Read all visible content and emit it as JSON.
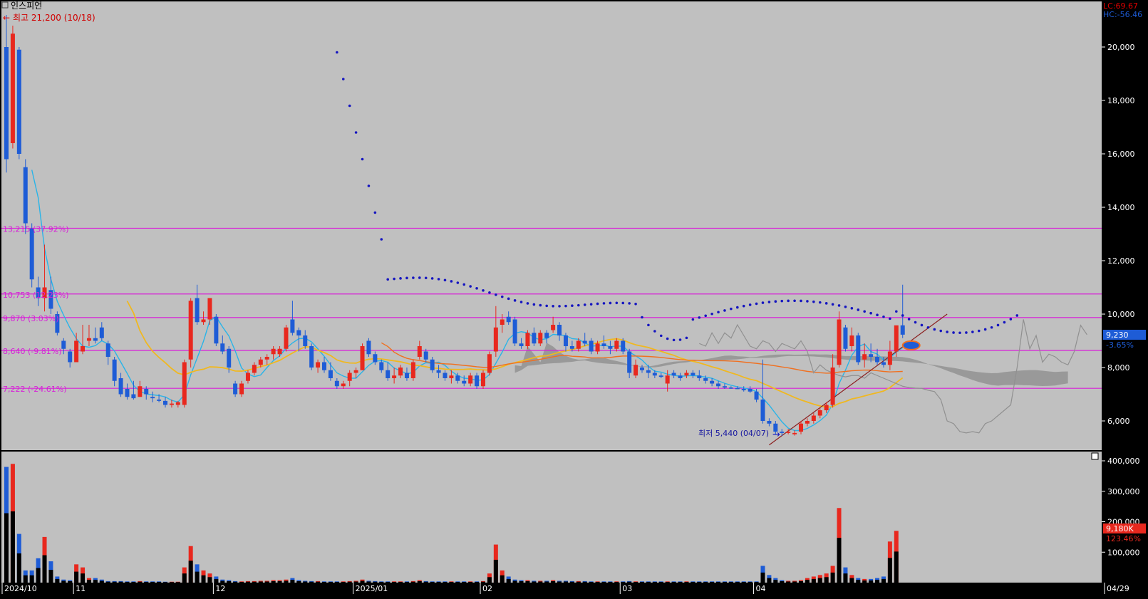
{
  "header": {
    "title": "인스피언",
    "high_label": "최고 21,200 (10/18)",
    "low_label": "최저 5,440 (04/07)"
  },
  "indicators": {
    "lc": "LC:69.67",
    "hc": "HC:-56.46"
  },
  "price_box": {
    "value": "9,230",
    "change": "-3.65%"
  },
  "volume_box": {
    "value": "9,180K",
    "pct": "123.46%"
  },
  "colors": {
    "up": "#e8281e",
    "down": "#1e5cd6",
    "sar": "#1515c0",
    "line_pink": "#d81fd8",
    "ma_cyan": "#29b4e8",
    "ma_yellow": "#f0b820",
    "ma_orange": "#f07020"
  },
  "chart_data": [
    {
      "type": "candlestick",
      "y_ticks": [
        "20,000",
        "18,000",
        "16,000",
        "14,000",
        "12,000",
        "10,000",
        "8,000",
        "6,000"
      ],
      "ylim": [
        5000,
        22000
      ],
      "x_labels": [
        {
          "label": "2024/10",
          "i": 0
        },
        {
          "label": "11",
          "i": 11
        },
        {
          "label": "12",
          "i": 33
        },
        {
          "label": "2025/01",
          "i": 55
        },
        {
          "label": "02",
          "i": 75
        },
        {
          "label": "03",
          "i": 97
        },
        {
          "label": "04",
          "i": 118
        },
        {
          "label": "04/29",
          "i": 174
        }
      ],
      "ohlc": [
        [
          20000,
          21200,
          15300,
          15800
        ],
        [
          16400,
          20800,
          16200,
          20500
        ],
        [
          19900,
          20000,
          15800,
          16000
        ],
        [
          15500,
          15800,
          13000,
          13400
        ],
        [
          13200,
          13400,
          11000,
          11300
        ],
        [
          11000,
          11400,
          10300,
          10600
        ],
        [
          10600,
          12600,
          10100,
          11000
        ],
        [
          10900,
          11400,
          10000,
          10200
        ],
        [
          10000,
          10100,
          9200,
          9300
        ],
        [
          9000,
          9100,
          8500,
          8700
        ],
        [
          8600,
          8700,
          8000,
          8200
        ],
        [
          8200,
          9300,
          8200,
          9000
        ],
        [
          8600,
          9600,
          8500,
          8800
        ],
        [
          9000,
          9600,
          8800,
          9100
        ],
        [
          9100,
          9500,
          8900,
          9000
        ],
        [
          9500,
          9700,
          9000,
          9100
        ],
        [
          8900,
          9000,
          8100,
          8400
        ],
        [
          8300,
          8400,
          7300,
          7500
        ],
        [
          7600,
          7800,
          6900,
          7000
        ],
        [
          7200,
          7400,
          6800,
          6900
        ],
        [
          7000,
          7500,
          6800,
          6850
        ],
        [
          6900,
          7500,
          6900,
          7300
        ],
        [
          7200,
          7300,
          6800,
          7000
        ],
        [
          6900,
          7100,
          6700,
          6850
        ],
        [
          6800,
          7000,
          6700,
          6750
        ],
        [
          6750,
          6900,
          6500,
          6600
        ],
        [
          6600,
          6800,
          6500,
          6650
        ],
        [
          6600,
          6750,
          6500,
          6700
        ],
        [
          6600,
          8300,
          6500,
          8200
        ],
        [
          8300,
          10600,
          8000,
          10500
        ],
        [
          10600,
          11100,
          9600,
          9700
        ],
        [
          9700,
          10100,
          9600,
          9800
        ],
        [
          9800,
          10600,
          9600,
          10600
        ],
        [
          9900,
          10000,
          8800,
          8900
        ],
        [
          8900,
          9200,
          8500,
          8600
        ],
        [
          8700,
          8800,
          7800,
          8000
        ],
        [
          7400,
          7500,
          6900,
          7000
        ],
        [
          7000,
          7500,
          6900,
          7400
        ],
        [
          7500,
          7900,
          7400,
          7800
        ],
        [
          7800,
          8200,
          7700,
          8100
        ],
        [
          8100,
          8400,
          8000,
          8300
        ],
        [
          8300,
          8500,
          8100,
          8400
        ],
        [
          8500,
          8800,
          8300,
          8700
        ],
        [
          8500,
          8800,
          8400,
          8700
        ],
        [
          8700,
          9600,
          8600,
          9500
        ],
        [
          9800,
          10500,
          9200,
          9300
        ],
        [
          9400,
          9500,
          8600,
          9200
        ],
        [
          9200,
          9400,
          8700,
          8800
        ],
        [
          8800,
          8900,
          7900,
          8000
        ],
        [
          8000,
          8300,
          7800,
          8200
        ],
        [
          8200,
          8400,
          7800,
          7900
        ],
        [
          7900,
          8200,
          7500,
          7600
        ],
        [
          7500,
          7600,
          7200,
          7300
        ],
        [
          7300,
          7500,
          7200,
          7400
        ],
        [
          7500,
          7900,
          7300,
          7800
        ],
        [
          7800,
          8000,
          7600,
          7900
        ],
        [
          7900,
          8900,
          7900,
          8800
        ],
        [
          9000,
          9100,
          8400,
          8500
        ],
        [
          8500,
          8600,
          8100,
          8200
        ],
        [
          8200,
          8300,
          7800,
          7900
        ],
        [
          7900,
          8200,
          7500,
          7600
        ],
        [
          7600,
          8000,
          7400,
          7700
        ],
        [
          7700,
          8100,
          7600,
          8000
        ],
        [
          7800,
          8000,
          7500,
          7600
        ],
        [
          7600,
          8300,
          7500,
          8200
        ],
        [
          8400,
          9000,
          8300,
          8800
        ],
        [
          8600,
          8700,
          8200,
          8300
        ],
        [
          8300,
          8400,
          7800,
          7900
        ],
        [
          7900,
          8100,
          7600,
          7800
        ],
        [
          7800,
          7900,
          7500,
          7600
        ],
        [
          7600,
          7900,
          7400,
          7700
        ],
        [
          7700,
          7800,
          7400,
          7500
        ],
        [
          7500,
          7700,
          7300,
          7400
        ],
        [
          7400,
          7800,
          7300,
          7700
        ],
        [
          7700,
          7800,
          7200,
          7300
        ],
        [
          7300,
          7900,
          7200,
          7800
        ],
        [
          7800,
          8600,
          7700,
          8500
        ],
        [
          8600,
          10300,
          8400,
          9500
        ],
        [
          9600,
          10000,
          9300,
          9800
        ],
        [
          9900,
          10100,
          9600,
          9700
        ],
        [
          9800,
          9900,
          8800,
          8900
        ],
        [
          8900,
          9100,
          8700,
          8800
        ],
        [
          8800,
          9400,
          8700,
          9300
        ],
        [
          9300,
          9500,
          8800,
          8900
        ],
        [
          8900,
          9400,
          8800,
          9300
        ],
        [
          9300,
          9400,
          8900,
          9100
        ],
        [
          9400,
          9900,
          9300,
          9600
        ],
        [
          9600,
          9700,
          9000,
          9200
        ],
        [
          9200,
          9300,
          8600,
          8800
        ],
        [
          8800,
          9000,
          8600,
          8700
        ],
        [
          8700,
          9100,
          8600,
          9000
        ],
        [
          9000,
          9300,
          8800,
          8900
        ],
        [
          9000,
          9100,
          8500,
          8600
        ],
        [
          8600,
          9000,
          8500,
          8900
        ],
        [
          8900,
          9200,
          8700,
          8800
        ],
        [
          8800,
          9000,
          8500,
          8700
        ],
        [
          8700,
          9100,
          8600,
          9000
        ],
        [
          9000,
          9100,
          8500,
          8600
        ],
        [
          8600,
          8700,
          7600,
          7800
        ],
        [
          7700,
          8300,
          7600,
          8100
        ],
        [
          8000,
          8100,
          7800,
          7900
        ],
        [
          7900,
          8100,
          7600,
          7800
        ],
        [
          7800,
          7900,
          7600,
          7700
        ],
        [
          7700,
          7800,
          7600,
          7650
        ],
        [
          7400,
          7900,
          7100,
          7700
        ],
        [
          7800,
          7900,
          7600,
          7700
        ],
        [
          7700,
          7800,
          7500,
          7600
        ],
        [
          7700,
          7900,
          7600,
          7800
        ],
        [
          7800,
          7900,
          7600,
          7700
        ],
        [
          7700,
          7900,
          7500,
          7600
        ],
        [
          7600,
          7700,
          7400,
          7500
        ],
        [
          7500,
          7600,
          7300,
          7400
        ],
        [
          7400,
          7500,
          7200,
          7300
        ],
        [
          7300,
          7400,
          7200,
          7250
        ],
        [
          7250,
          7300,
          7200,
          7230
        ],
        [
          7230,
          7300,
          7200,
          7220
        ],
        [
          7200,
          7300,
          7100,
          7150
        ],
        [
          7200,
          7300,
          7050,
          7100
        ],
        [
          7100,
          7200,
          6700,
          6800
        ],
        [
          6800,
          8300,
          5900,
          6000
        ],
        [
          6000,
          6100,
          5800,
          5900
        ],
        [
          5900,
          6000,
          5500,
          5600
        ],
        [
          5600,
          5700,
          5440,
          5550
        ],
        [
          5550,
          5700,
          5500,
          5600
        ],
        [
          5500,
          5650,
          5450,
          5550
        ],
        [
          5600,
          6000,
          5500,
          5900
        ],
        [
          5900,
          6100,
          5800,
          6000
        ],
        [
          6000,
          6300,
          5900,
          6200
        ],
        [
          6200,
          6500,
          6100,
          6400
        ],
        [
          6400,
          6700,
          6300,
          6600
        ],
        [
          6600,
          8500,
          6500,
          8000
        ],
        [
          8100,
          10100,
          8000,
          9800
        ],
        [
          9500,
          9600,
          8600,
          8700
        ],
        [
          8800,
          9500,
          8600,
          9200
        ],
        [
          9200,
          9300,
          8100,
          8200
        ],
        [
          8300,
          8900,
          8000,
          8500
        ],
        [
          8500,
          8900,
          8200,
          8400
        ],
        [
          8400,
          8700,
          8100,
          8200
        ],
        [
          8200,
          8400,
          8000,
          8100
        ],
        [
          8100,
          9000,
          7900,
          8600
        ],
        [
          8600,
          9300,
          8400,
          9580
        ],
        [
          9580,
          11100,
          9100,
          9230
        ]
      ],
      "volume": [
        380,
        390,
        160,
        40,
        40,
        80,
        150,
        70,
        20,
        10,
        8,
        60,
        50,
        15,
        15,
        10,
        5,
        5,
        5,
        4,
        4,
        5,
        4,
        4,
        4,
        3,
        3,
        3,
        50,
        120,
        60,
        40,
        30,
        20,
        10,
        8,
        5,
        4,
        5,
        5,
        6,
        6,
        8,
        8,
        10,
        15,
        8,
        6,
        5,
        5,
        4,
        4,
        4,
        4,
        5,
        6,
        10,
        6,
        5,
        4,
        4,
        4,
        4,
        4,
        5,
        8,
        5,
        4,
        4,
        4,
        4,
        4,
        4,
        4,
        4,
        5,
        30,
        125,
        40,
        20,
        10,
        8,
        8,
        6,
        6,
        6,
        8,
        6,
        6,
        5,
        5,
        5,
        4,
        4,
        4,
        4,
        4,
        4,
        5,
        4,
        4,
        4,
        4,
        4,
        4,
        4,
        4,
        4,
        4,
        4,
        4,
        4,
        4,
        4,
        4,
        4,
        4,
        4,
        4,
        55,
        25,
        15,
        8,
        6,
        6,
        8,
        15,
        20,
        25,
        30,
        55,
        245,
        50,
        25,
        15,
        12,
        12,
        15,
        20,
        135,
        170
      ],
      "volume_ticks": [
        "400,000",
        "300,000",
        "200,000",
        "100,000"
      ],
      "hlines": [
        {
          "price": 13215,
          "label": "13,215 (37.92%)"
        },
        {
          "price": 10753,
          "label": "10,753 (12.23%)"
        },
        {
          "price": 9870,
          "label": "9,870 (3.03%)"
        },
        {
          "price": 8640,
          "label": "8,640 (-9.81%)"
        },
        {
          "price": 7222,
          "label": "7,222 (-24.61%)"
        }
      ]
    }
  ]
}
